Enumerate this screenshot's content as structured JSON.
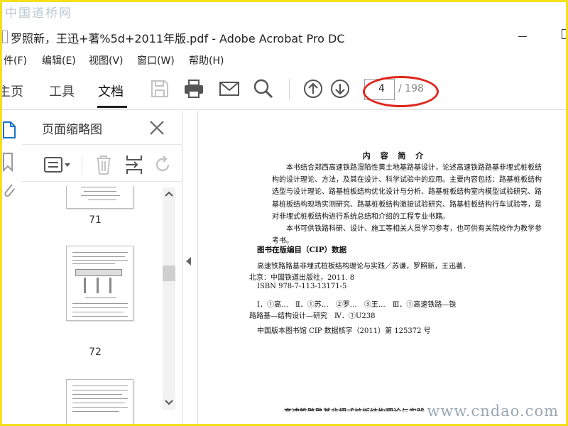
{
  "watermark": {
    "top": "中国道桥网",
    "bottom": "www.cndao.com"
  },
  "window": {
    "title": "罗照新，王迅+著%5d+2011年版.pdf - Adobe Acrobat Pro DC"
  },
  "menu": [
    "件(F)",
    "编辑(E)",
    "视图(V)",
    "窗口(W)",
    "帮助(H)"
  ],
  "tabs": {
    "home": "主页",
    "tools": "工具",
    "document": "文档"
  },
  "navigation": {
    "current_page": "4",
    "total_pages": "/ 198"
  },
  "colors": {
    "highlight": "#e1261c",
    "watermark_border": "#f4e01c",
    "active_rail_icon": "#1a73c9"
  },
  "thumbnails_panel": {
    "title": "页面缩略图",
    "pages": [
      {
        "label": "71"
      },
      {
        "label": "72"
      }
    ]
  },
  "document": {
    "heading": "内 容 简 介",
    "paragraphs": [
      "本书结合郑西高速铁路湿陷性黄土地基路基设计，论述高速铁路路基非埋式桩板结构的设计理论、方法，及其在设计、科学试验中的应用。主要内容包括：路基桩板结构选型与设计理论、路基桩板结构优化设计与分析、路基桩板结构室内模型试验研究、路基桩板结构现场实测研究、路基桩板结构激振试验研究、路基桩板结构行车试验等，是对非埋式桩板结构进行系统总结和介绍的工程专业书籍。",
      "本书可供铁路科研、设计、施工等相关人员学习参考，也可供有关院校作为教学参考书。"
    ],
    "cip_title": "图书在版编目（CIP）数据",
    "cip_lines": [
      "高速铁路路基非埋式桩板结构理论与实践／苏谦，罗照新，王迅著．",
      "北京：中国铁道出版社，2011. 8",
      "ISBN 978-7-113-13171-5",
      "Ⅰ．①高…　Ⅱ．①苏…　②罗…　③王…　Ⅲ．①高速铁路—铁",
      "路路基—结构设计—研究　Ⅳ．①U238",
      "中国版本图书馆 CIP 数据核字（2011）第 125372 号"
    ],
    "next_title": "高速铁路路基非埋式桩板结构理论与实践"
  }
}
